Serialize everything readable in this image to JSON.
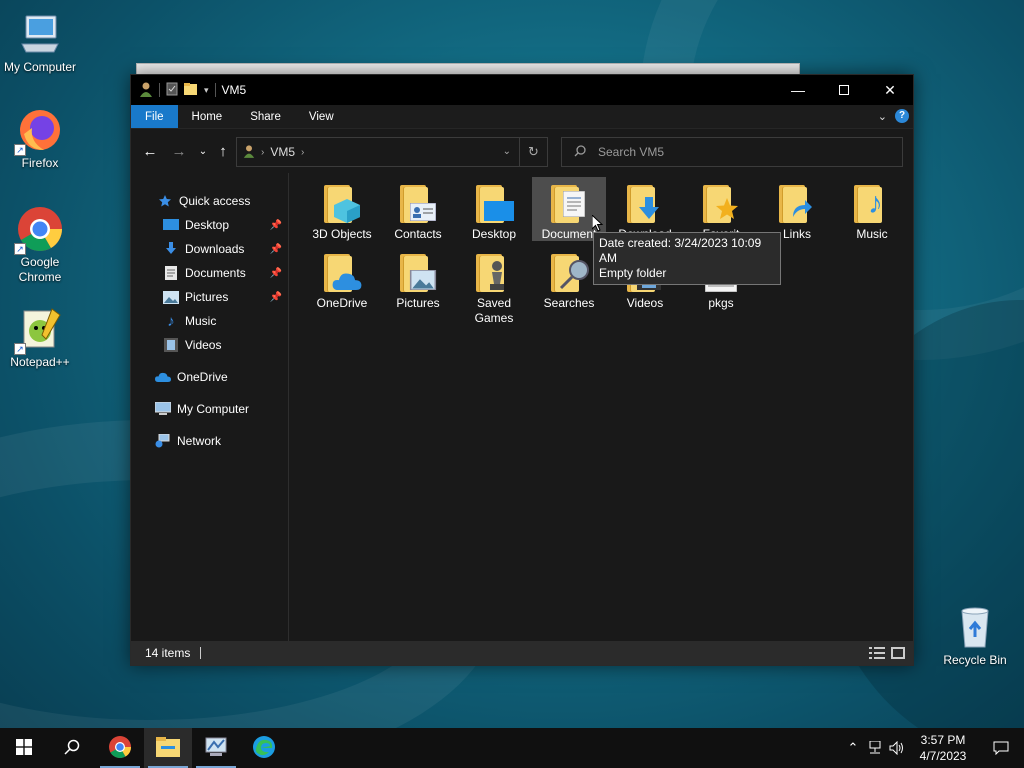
{
  "desktop": {
    "icons": [
      {
        "label": "My Computer",
        "icon": "computer-icon"
      },
      {
        "label": "Firefox",
        "icon": "firefox-icon"
      },
      {
        "label": "Google\nChrome",
        "icon": "chrome-icon"
      },
      {
        "label": "Notepad++",
        "icon": "notepadpp-icon"
      },
      {
        "label": "Recycle Bin",
        "icon": "recycle-bin-icon"
      }
    ]
  },
  "window": {
    "title": "VM5",
    "ribbon_tabs": [
      "File",
      "Home",
      "Share",
      "View"
    ],
    "address_path": "VM5",
    "search_placeholder": "Search VM5",
    "colors": {
      "accent": "#1979ca",
      "folder": "#f7d774",
      "background": "#191919"
    }
  },
  "nav_pane": {
    "quick_access": "Quick access",
    "quick_items": [
      {
        "label": "Desktop",
        "pinned": true,
        "icon": "desktop-icon"
      },
      {
        "label": "Downloads",
        "pinned": true,
        "icon": "downloads-icon"
      },
      {
        "label": "Documents",
        "pinned": true,
        "icon": "documents-icon"
      },
      {
        "label": "Pictures",
        "pinned": true,
        "icon": "pictures-icon"
      },
      {
        "label": "Music",
        "pinned": false,
        "icon": "music-icon"
      },
      {
        "label": "Videos",
        "pinned": false,
        "icon": "videos-icon"
      }
    ],
    "onedrive": "OneDrive",
    "my_computer": "My Computer",
    "network": "Network"
  },
  "content": {
    "items": [
      {
        "label": "3D Objects",
        "icon": "3d-objects-folder-icon"
      },
      {
        "label": "Contacts",
        "icon": "contacts-folder-icon"
      },
      {
        "label": "Desktop",
        "icon": "desktop-folder-icon"
      },
      {
        "label": "Documents",
        "icon": "documents-folder-icon",
        "selected": true
      },
      {
        "label": "Downloads",
        "icon": "downloads-folder-icon"
      },
      {
        "label": "Favorites",
        "icon": "favorites-folder-icon"
      },
      {
        "label": "Links",
        "icon": "links-folder-icon"
      },
      {
        "label": "Music",
        "icon": "music-folder-icon"
      },
      {
        "label": "OneDrive",
        "icon": "onedrive-folder-icon"
      },
      {
        "label": "Pictures",
        "icon": "pictures-folder-icon"
      },
      {
        "label": "Saved\nGames",
        "icon": "saved-games-folder-icon"
      },
      {
        "label": "Searches",
        "icon": "searches-folder-icon"
      },
      {
        "label": "Videos",
        "icon": "videos-folder-icon"
      },
      {
        "label": "pkgs",
        "icon": "file-icon"
      }
    ],
    "visible_labels": {
      "documents": "Document",
      "downloads": "Download",
      "favorites": "Favorit"
    },
    "tooltip": {
      "line1": "Date created: 3/24/2023 10:09 AM",
      "line2": "Empty folder"
    }
  },
  "status": {
    "item_count": "14 items"
  },
  "taskbar": {
    "time": "3:57 PM",
    "date": "4/7/2023",
    "apps": [
      "start-icon",
      "search-icon",
      "chrome-icon",
      "file-explorer-icon",
      "control-panel-icon",
      "edge-icon"
    ]
  }
}
